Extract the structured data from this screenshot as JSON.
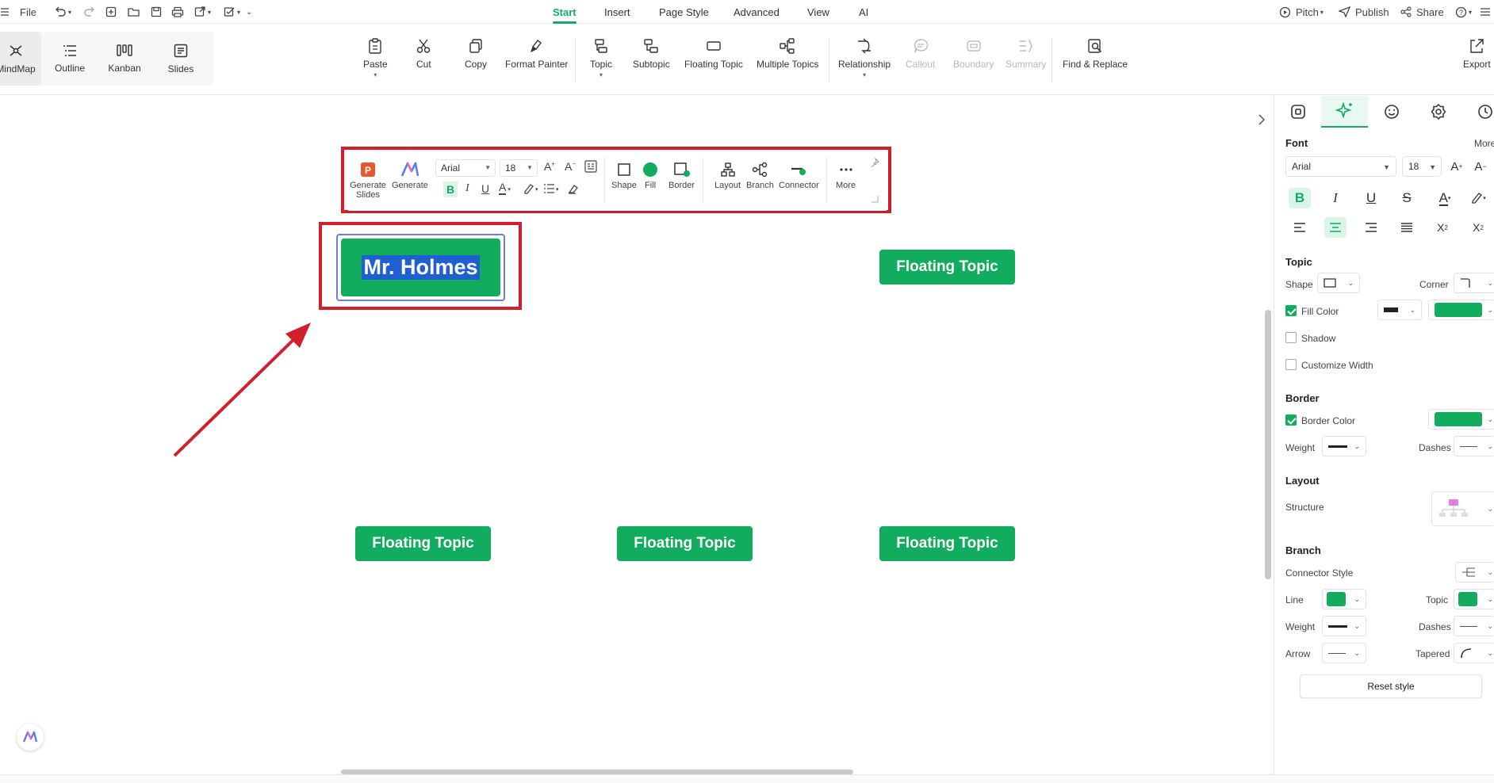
{
  "topbar": {
    "file_label": "File",
    "menu_tabs": [
      "Start",
      "Insert",
      "Page Style",
      "Advanced",
      "View",
      "AI"
    ],
    "active_tab": "Start",
    "right": {
      "pitch": "Pitch",
      "publish": "Publish",
      "share": "Share"
    }
  },
  "views": [
    {
      "label": "MindMap",
      "icon": "mindmap-icon",
      "active": true
    },
    {
      "label": "Outline",
      "icon": "outline-icon"
    },
    {
      "label": "Kanban",
      "icon": "kanban-icon"
    },
    {
      "label": "Slides",
      "icon": "slides-icon"
    }
  ],
  "ribbon": {
    "paste": "Paste",
    "cut": "Cut",
    "copy": "Copy",
    "format_painter": "Format Painter",
    "topic": "Topic",
    "subtopic": "Subtopic",
    "floating_topic": "Floating Topic",
    "multiple_topics": "Multiple Topics",
    "relationship": "Relationship",
    "callout": "Callout",
    "boundary": "Boundary",
    "summary": "Summary",
    "find_replace": "Find & Replace",
    "export": "Export"
  },
  "floating_toolbar": {
    "generate_slides": "Generate Slides",
    "generate": "Generate",
    "font": "Arial",
    "size": "18",
    "shape": "Shape",
    "fill": "Fill",
    "border": "Border",
    "layout": "Layout",
    "branch": "Branch",
    "connector": "Connector",
    "more": "More"
  },
  "canvas": {
    "main_topic": "Mr. Holmes",
    "floating_topics": [
      "Floating Topic",
      "Floating Topic",
      "Floating Topic",
      "Floating Topic"
    ]
  },
  "panel": {
    "font_header": "Font",
    "more": "More",
    "font_family": "Arial",
    "font_size": "18",
    "topic_header": "Topic",
    "shape_label": "Shape",
    "corner_label": "Corner",
    "fill_color_label": "Fill Color",
    "fill_color_checked": true,
    "shadow_label": "Shadow",
    "shadow_checked": false,
    "customize_width_label": "Customize Width",
    "customize_width_checked": false,
    "border_header": "Border",
    "border_color_label": "Border Color",
    "border_color_checked": true,
    "weight_label": "Weight",
    "dashes_label": "Dashes",
    "layout_header": "Layout",
    "structure_label": "Structure",
    "branch_header": "Branch",
    "connector_style_label": "Connector Style",
    "line_label": "Line",
    "topic_label": "Topic",
    "branch_weight_label": "Weight",
    "branch_dashes_label": "Dashes",
    "arrow_label": "Arrow",
    "tapered_label": "Tapered",
    "reset_style": "Reset style"
  },
  "colors": {
    "accent": "#12a96a",
    "topic_fill": "#11ac5e",
    "annotation_red": "#d31f2c"
  }
}
